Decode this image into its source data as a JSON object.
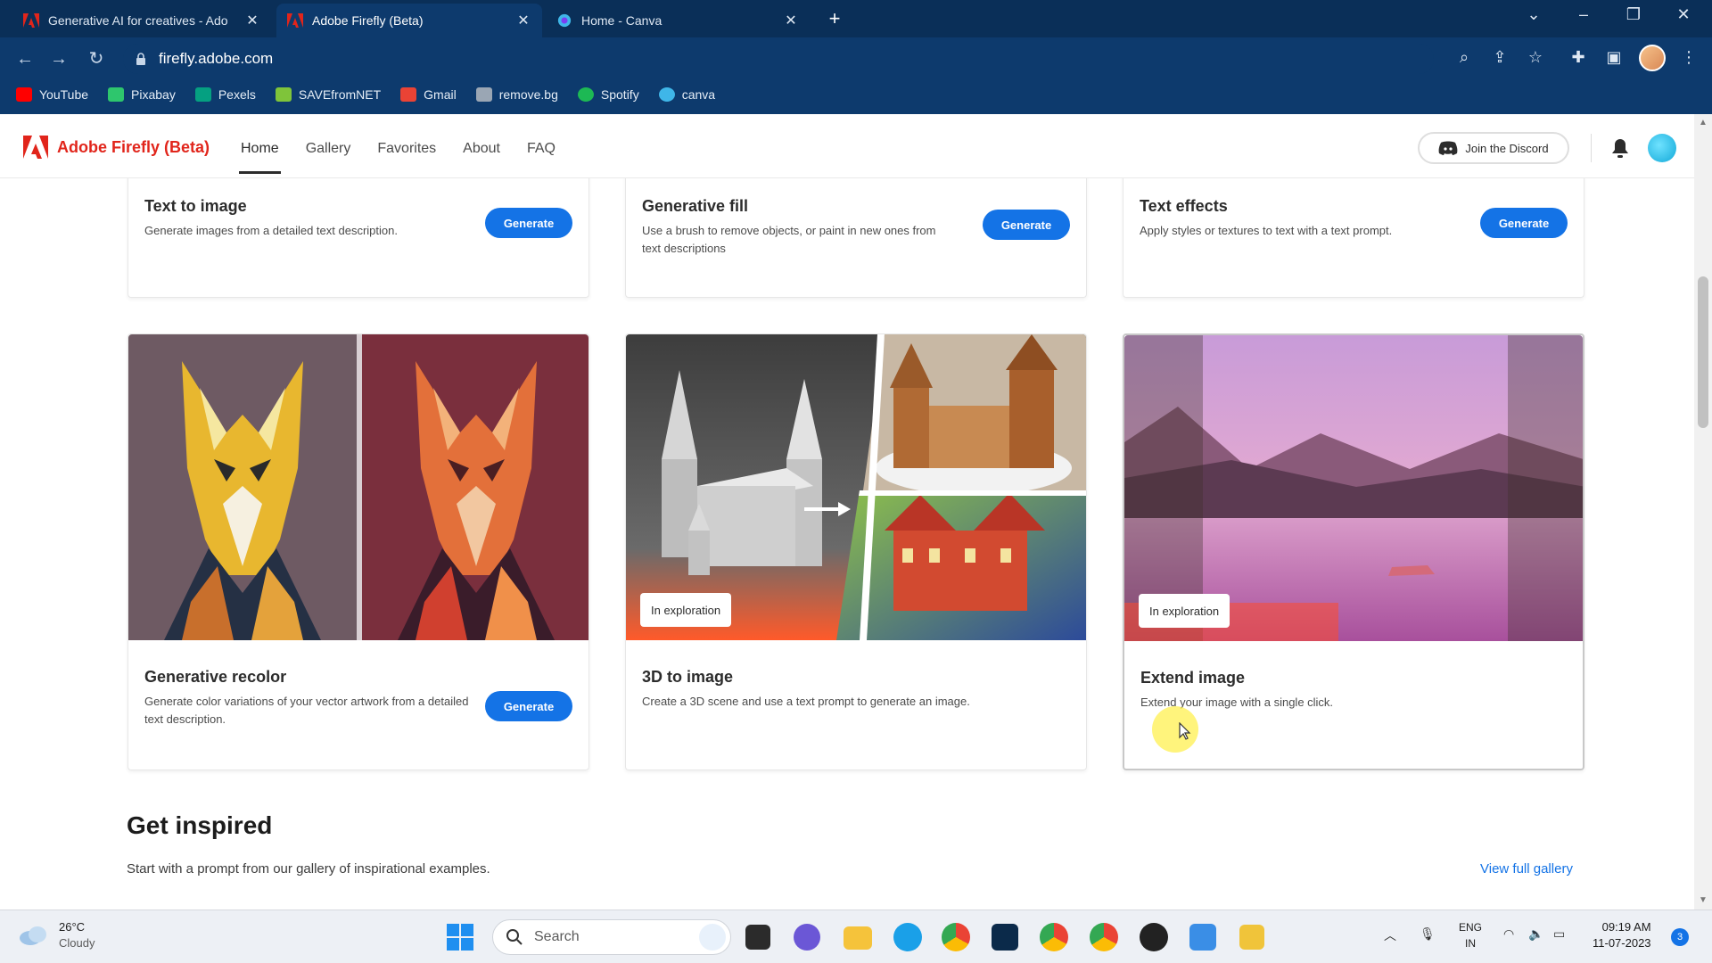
{
  "browser": {
    "tabs": [
      {
        "title": "Generative AI for creatives - Ado",
        "active": false
      },
      {
        "title": "Adobe Firefly (Beta)",
        "active": true
      },
      {
        "title": "Home - Canva",
        "active": false
      }
    ],
    "url": "firefly.adobe.com",
    "bookmarks": [
      "YouTube",
      "Pixabay",
      "Pexels",
      "SAVEfromNET",
      "Gmail",
      "remove.bg",
      "Spotify",
      "canva"
    ]
  },
  "header": {
    "brand": "Adobe Firefly (Beta)",
    "nav": [
      "Home",
      "Gallery",
      "Favorites",
      "About",
      "FAQ"
    ],
    "active_nav": "Home",
    "discord_label": "Join the Discord"
  },
  "top_cards": [
    {
      "title": "Text to image",
      "desc": "Generate images from a detailed text description.",
      "button": "Generate"
    },
    {
      "title": "Generative fill",
      "desc": "Use a brush to remove objects, or paint in new ones from text descriptions",
      "button": "Generate"
    },
    {
      "title": "Text effects",
      "desc": "Apply styles or textures to text with a text prompt.",
      "button": "Generate"
    }
  ],
  "feature_cards": [
    {
      "title": "Generative recolor",
      "desc": "Generate color variations of your vector artwork from a detailed text description.",
      "button": "Generate",
      "badge": ""
    },
    {
      "title": "3D to image",
      "desc": "Create a 3D scene and use a text prompt to generate an image.",
      "button": "",
      "badge": "In exploration"
    },
    {
      "title": "Extend image",
      "desc": "Extend your image with a single click.",
      "button": "",
      "badge": "In exploration"
    }
  ],
  "inspired": {
    "title": "Get inspired",
    "subtitle": "Start with a prompt from our gallery of inspirational examples.",
    "view_all": "View full gallery"
  },
  "taskbar": {
    "weather_temp": "26°C",
    "weather_cond": "Cloudy",
    "search_placeholder": "Search",
    "lang_line1": "ENG",
    "lang_line2": "IN",
    "time": "09:19 AM",
    "date": "11-07-2023",
    "notifications": "3"
  },
  "colors": {
    "accent": "#1473e6",
    "brand": "#e1251b",
    "chrome": "#0d3a6d"
  }
}
